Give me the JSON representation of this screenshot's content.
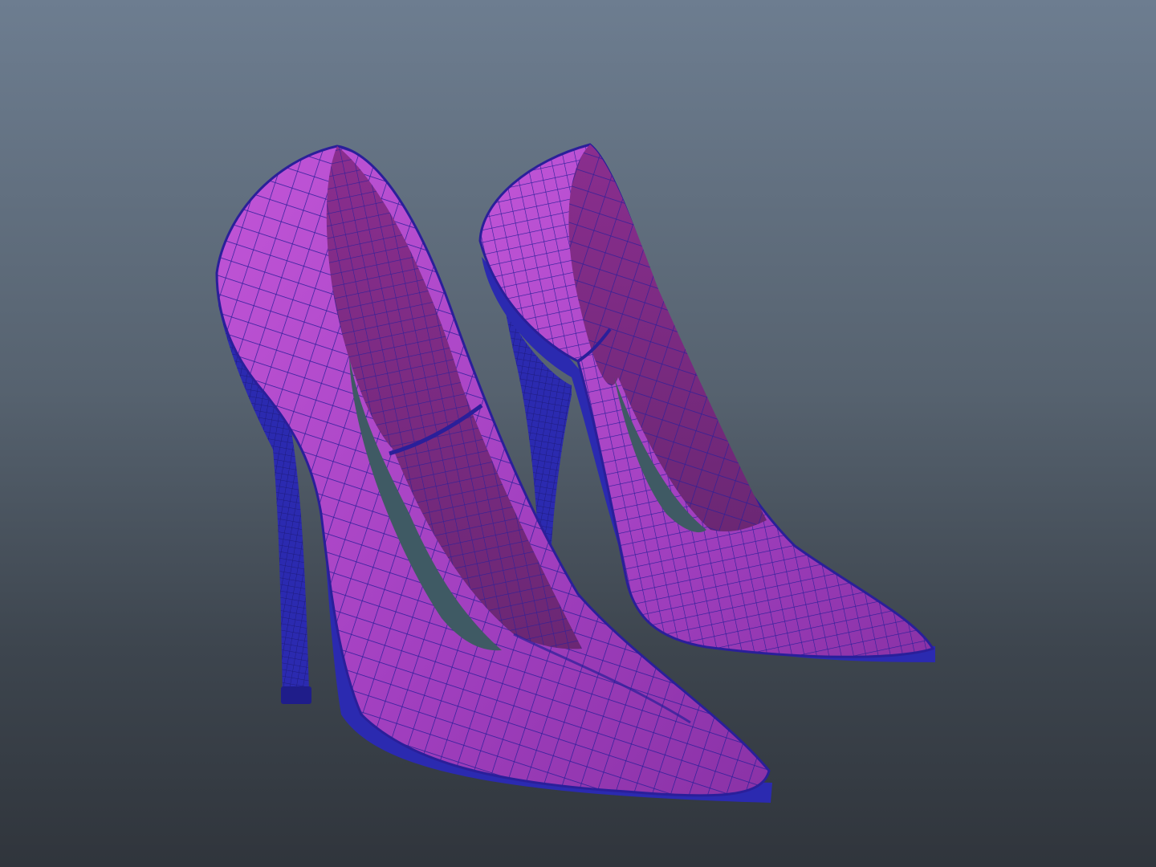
{
  "viewport": {
    "background_top": "#6d7d90",
    "background_bottom": "#30353c",
    "shading_mode": "smooth-shade-wireframe-on-shaded"
  },
  "model": {
    "objects": [
      "left-pump-shoe",
      "right-pump-shoe"
    ],
    "surface_color": "#a13fbf",
    "surface_highlight": "#c256d8",
    "wire_color": "#2a1f9a",
    "sole_color": "#2b2ab0",
    "interior_color": "#3f5a64"
  }
}
